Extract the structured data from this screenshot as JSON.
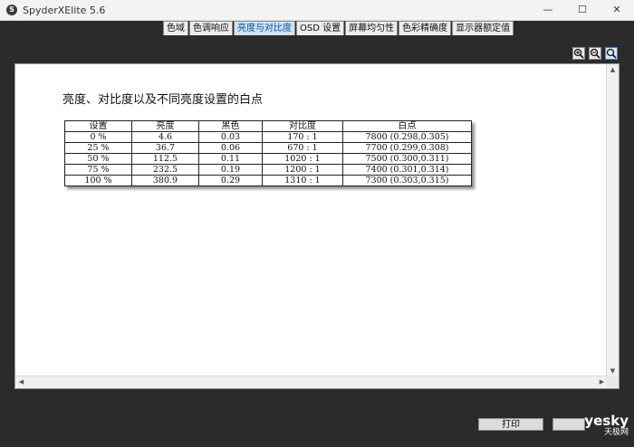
{
  "window": {
    "title": "SpyderXElite 5.6",
    "icon_glyph": "S",
    "min_glyph": "—",
    "max_glyph": "☐",
    "close_glyph": "✕"
  },
  "tabs": [
    {
      "label": "色域"
    },
    {
      "label": "色调响应"
    },
    {
      "label": "亮度与对比度",
      "active": true
    },
    {
      "label": "OSD 设置"
    },
    {
      "label": "屏幕均匀性"
    },
    {
      "label": "色彩精确度"
    },
    {
      "label": "显示器额定值"
    }
  ],
  "report": {
    "heading": "亮度、对比度以及不同亮度设置的白点",
    "columns": [
      "设置",
      "亮度",
      "黑色",
      "对比度",
      "白点"
    ],
    "rows": [
      [
        "0 %",
        "4.6",
        "0.03",
        "170 : 1",
        "7800 (0.298,0.305)"
      ],
      [
        "25 %",
        "36.7",
        "0.06",
        "670 : 1",
        "7700 (0.299,0.308)"
      ],
      [
        "50 %",
        "112.5",
        "0.11",
        "1020 : 1",
        "7500 (0.300,0.311)"
      ],
      [
        "75 %",
        "232.5",
        "0.19",
        "1200 : 1",
        "7400 (0.301,0.314)"
      ],
      [
        "100 %",
        "380.9",
        "0.29",
        "1310 : 1",
        "7300 (0.303,0.315)"
      ]
    ]
  },
  "buttons": {
    "print": "打印"
  },
  "watermark": {
    "line1": "yesky",
    "line2": "天极网"
  }
}
